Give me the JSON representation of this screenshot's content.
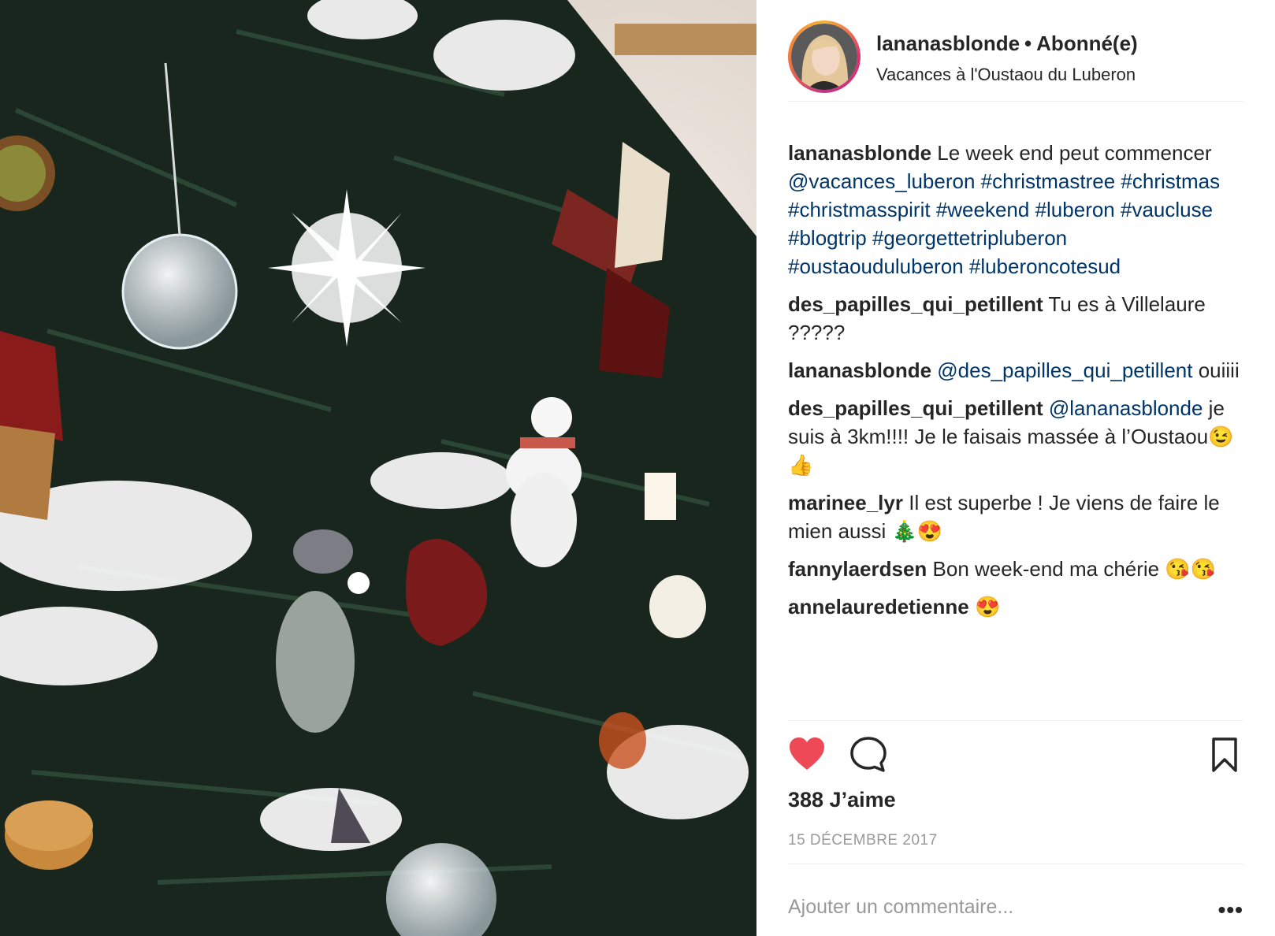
{
  "post": {
    "image_alt": "Sapin de Noël décoré",
    "header": {
      "username": "lananasblonde",
      "separator": "•",
      "follow_status": "Abonné(e)",
      "location": "Vacances à l'Oustaou du Luberon"
    },
    "caption": {
      "username": "lananasblonde",
      "text": "Le week end peut commencer",
      "mention": "@vacances_luberon",
      "hashtags": "#christmastree #christmas #christmasspirit #weekend #luberon #vaucluse #blogtrip #georgettetripluberon #oustaouduluberon #luberoncotesud"
    },
    "comments": [
      {
        "username": "des_papilles_qui_petillent",
        "mention": "",
        "text": "Tu es à Villelaure ?????"
      },
      {
        "username": "lananasblonde",
        "mention": "@des_papilles_qui_petillent",
        "text": "ouiiii"
      },
      {
        "username": "des_papilles_qui_petillent",
        "mention": "@lananasblonde",
        "text": "je suis à 3km!!!! Je le faisais massée à l’Oustaou😉👍"
      },
      {
        "username": "marinee_lyr",
        "mention": "",
        "text": "Il est superbe ! Je viens de faire le mien aussi 🎄😍"
      },
      {
        "username": "fannylaerdsen",
        "mention": "",
        "text": "Bon week-end ma chérie 😘😘"
      },
      {
        "username": "annelauredetienne",
        "mention": "",
        "text": "😍"
      }
    ],
    "actions": {
      "like_icon": "heart-filled-icon",
      "comment_icon": "comment-bubble-icon",
      "save_icon": "bookmark-icon",
      "liked": true,
      "like_color": "#ed4956"
    },
    "likes": "388 J’aime",
    "date": "15 DÉCEMBRE 2017",
    "add_comment": {
      "placeholder": "Ajouter un commentaire...",
      "more_label": "•••"
    }
  }
}
